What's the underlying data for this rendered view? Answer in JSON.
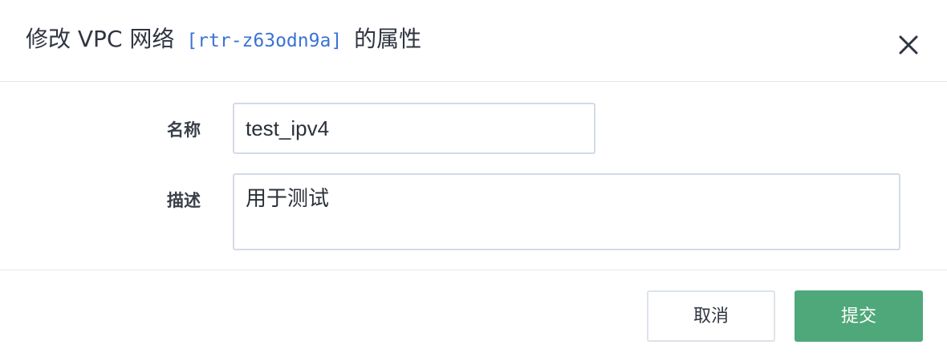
{
  "dialog": {
    "title_prefix": "修改 VPC 网络",
    "resource_id": "[rtr-z63odn9a]",
    "title_suffix": "的属性",
    "close_icon": "close-icon"
  },
  "form": {
    "name_label": "名称",
    "name_value": "test_ipv4",
    "description_label": "描述",
    "description_value": "用于测试"
  },
  "footer": {
    "cancel_label": "取消",
    "submit_label": "提交"
  },
  "colors": {
    "accent": "#4fa87a",
    "link": "#3b73d4",
    "border": "#d3dbe6"
  }
}
